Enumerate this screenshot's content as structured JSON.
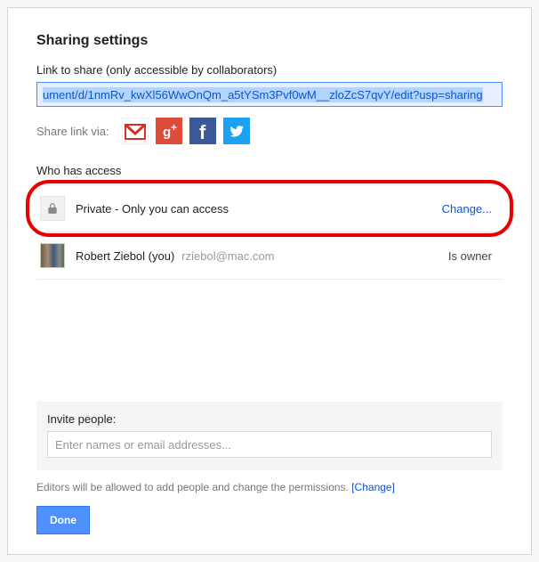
{
  "title": "Sharing settings",
  "link_label": "Link to share (only accessible by collaborators)",
  "share_url": "ument/d/1nmRv_kwXl56WwOnQm_a5tYSm3Pvf0wM__zloZcS7qvY/edit?usp=sharing",
  "share_via_label": "Share link via:",
  "services": {
    "gmail": "gmail-icon",
    "gplus": "google-plus-icon",
    "facebook": "facebook-icon",
    "twitter": "twitter-icon"
  },
  "access_label": "Who has access",
  "access": {
    "privacy": {
      "text": "Private - Only you can access",
      "action": "Change..."
    },
    "owner": {
      "name": "Robert Ziebol (you)",
      "email": "rziebol@mac.com",
      "role": "Is owner"
    }
  },
  "invite": {
    "label": "Invite people:",
    "placeholder": "Enter names or email addresses..."
  },
  "footer": {
    "note": "Editors will be allowed to add people and change the permissions.  ",
    "change": "[Change]"
  },
  "done_label": "Done"
}
